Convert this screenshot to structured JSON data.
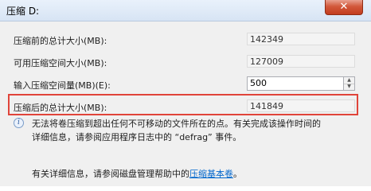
{
  "window": {
    "title": "压缩 D:",
    "close_label": "✕"
  },
  "fields": {
    "total_before_label": "压缩前的总计大小(MB):",
    "total_before_value": "142349",
    "available_label": "可用压缩空间大小(MB):",
    "available_value": "127009",
    "input_label": "输入压缩空间量(MB)(E):",
    "input_value": "500",
    "total_after_label": "压缩后的总计大小(MB):",
    "total_after_value": "141849"
  },
  "info": {
    "line1": "无法将卷压缩到超出任何不可移动的文件所在的点。有关完成该操作时间的",
    "line2": "详细信息，请参阅应用程序日志中的 “defrag” 事件。"
  },
  "footer": {
    "prefix": "有关详细信息，请参阅磁盘管理帮助中的",
    "link": "压缩基本卷",
    "suffix": "。"
  }
}
